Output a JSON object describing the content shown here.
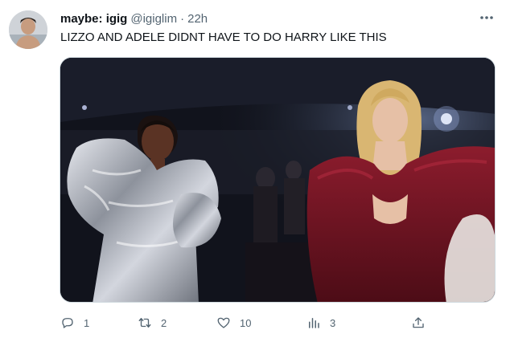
{
  "tweet": {
    "display_name": "maybe: igig",
    "handle": "@igiglim",
    "separator": "·",
    "time": "22h",
    "text": "LIZZO AND ADELE DIDNT HAVE TO DO HARRY LIKE THIS"
  },
  "actions": {
    "reply_count": "1",
    "retweet_count": "2",
    "like_count": "10",
    "views_count": "3"
  },
  "icons": {
    "more": "more-icon",
    "reply": "reply-icon",
    "retweet": "retweet-icon",
    "like": "heart-icon",
    "views": "views-icon",
    "share": "share-icon"
  },
  "colors": {
    "text": "#0f1419",
    "secondary": "#536471",
    "border": "#cfd9de",
    "dress_silver": "#b9bdc6",
    "dress_burgundy": "#6d1422"
  }
}
